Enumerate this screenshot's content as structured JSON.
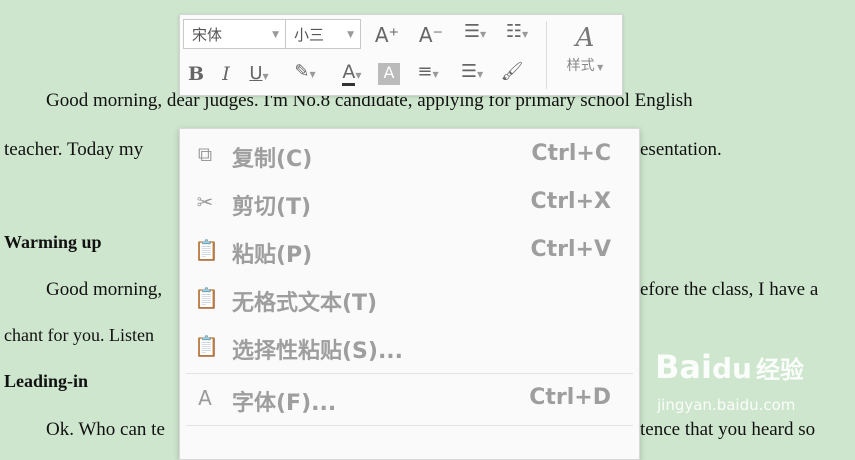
{
  "document": {
    "line1": "Good morning, dear judges. I'm No.8 candidate, applying for primary school English",
    "line2_left": "teacher. Today my",
    "line2_right": "esentation.",
    "heading_warming": "Warming up",
    "line3_left": "Good morning,",
    "line3_right": "efore the class, I have a",
    "line4_left": "chant for you. Listen",
    "heading_leading": "Leading-in",
    "line5_left": "Ok. Who can te",
    "line5_right": "tence that you heard so"
  },
  "toolbar": {
    "font_name": "宋体",
    "font_size": "小三",
    "styles_label": "样式",
    "buttons": {
      "grow": "A⁺",
      "shrink": "A⁻",
      "bold": "B",
      "italic": "I",
      "underline": "U",
      "font_color": "A"
    }
  },
  "context_menu": {
    "items": [
      {
        "label": "复制(C)",
        "shortcut": "Ctrl+C",
        "icon": "copy-icon"
      },
      {
        "label": "剪切(T)",
        "shortcut": "Ctrl+X",
        "icon": "scissors-icon"
      },
      {
        "label": "粘贴(P)",
        "shortcut": "Ctrl+V",
        "icon": "paste-icon"
      },
      {
        "label": "无格式文本(T)",
        "shortcut": "",
        "icon": "paste-plain-icon"
      },
      {
        "label": "选择性粘贴(S)...",
        "shortcut": "",
        "icon": "paste-special-icon"
      },
      {
        "label": "字体(F)...",
        "shortcut": "Ctrl+D",
        "icon": "font-icon"
      }
    ]
  },
  "watermark": {
    "brand": "Bai",
    "brand2": "经验",
    "url": "jingyan.baidu.com"
  },
  "colors": {
    "page_bg": "#cde6cd",
    "menu_text_disabled": "#9e9e9e"
  }
}
